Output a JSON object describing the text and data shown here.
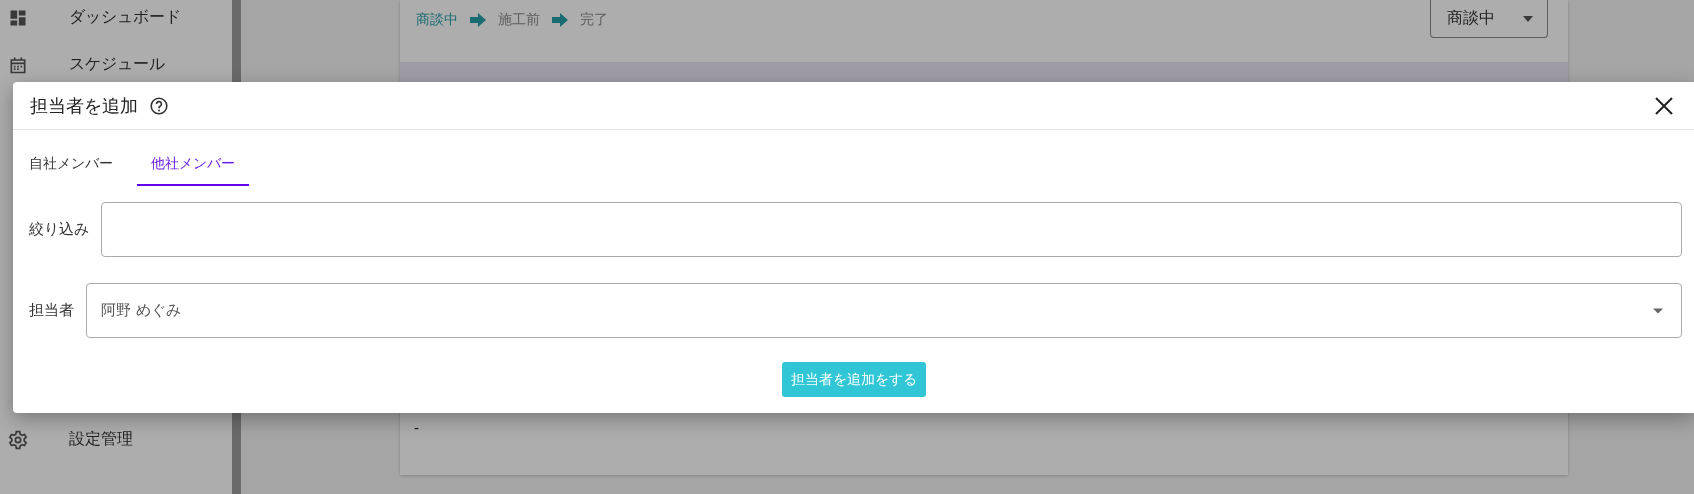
{
  "sidebar": {
    "items": [
      {
        "kind": "dashboard",
        "label": "ダッシュボード"
      },
      {
        "kind": "calendar",
        "label": "スケジュール"
      },
      {
        "kind": "gear",
        "label": "設定管理"
      }
    ]
  },
  "progress": {
    "steps": [
      {
        "label": "商談中",
        "current": true
      },
      {
        "label": "施工前",
        "current": false
      },
      {
        "label": "完了",
        "current": false
      }
    ]
  },
  "status_select": {
    "value": "商談中"
  },
  "detail": {
    "value": "-"
  },
  "dialog": {
    "title": "担当者を追加",
    "tabs": [
      {
        "label": "自社メンバー",
        "selected": false
      },
      {
        "label": "他社メンバー",
        "selected": true
      }
    ],
    "fields": [
      {
        "kind": "text",
        "label": "絞り込み"
      },
      {
        "kind": "select",
        "label": "担当者",
        "value": "阿野 めぐみ"
      }
    ],
    "submit": "担当者を追加をする"
  }
}
